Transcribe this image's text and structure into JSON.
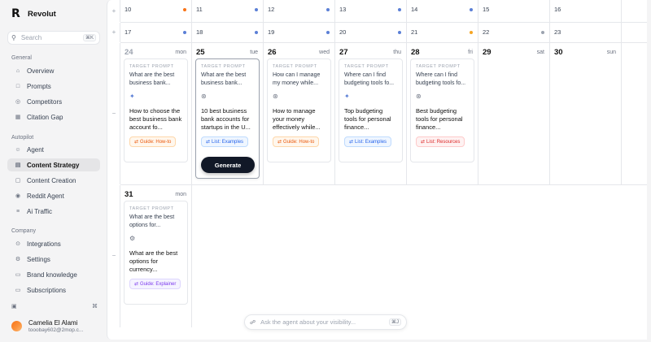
{
  "brand": {
    "logo": "R",
    "name": "Revolut"
  },
  "search": {
    "placeholder": "Search",
    "shortcut": "⌘K"
  },
  "sidebar": {
    "general_label": "General",
    "general": [
      {
        "label": "Overview",
        "icon": "house-icon"
      },
      {
        "label": "Prompts",
        "icon": "chat-icon"
      },
      {
        "label": "Competitors",
        "icon": "target-icon"
      },
      {
        "label": "Citation Gap",
        "icon": "grid-icon"
      }
    ],
    "autopilot_label": "Autopilot",
    "autopilot": [
      {
        "label": "Agent",
        "icon": "bot-icon"
      },
      {
        "label": "Content Strategy",
        "icon": "calendar-icon",
        "active": true
      },
      {
        "label": "Content Creation",
        "icon": "doc-icon"
      },
      {
        "label": "Reddit Agent",
        "icon": "reddit-icon"
      },
      {
        "label": "Ai Traffic",
        "icon": "traffic-icon"
      }
    ],
    "company_label": "Company",
    "company": [
      {
        "label": "Integrations",
        "icon": "plug-icon"
      },
      {
        "label": "Settings",
        "icon": "gear-icon"
      },
      {
        "label": "Brand knowledge",
        "icon": "book-icon"
      },
      {
        "label": "Subscriptions",
        "icon": "card-icon"
      }
    ],
    "footer_shortcut": "⌘",
    "user": {
      "name": "Camelia El Alami",
      "email": "tooobay602@2mop.c..."
    }
  },
  "calendar": {
    "week1": [
      {
        "day": "10",
        "dot": "#f97316"
      },
      {
        "day": "11",
        "dot": "#5b7fd6"
      },
      {
        "day": "12",
        "dot": "#5b7fd6"
      },
      {
        "day": "13",
        "dot": "#5b7fd6"
      },
      {
        "day": "14",
        "dot": "#5b7fd6"
      },
      {
        "day": "15",
        "dot": ""
      },
      {
        "day": "16",
        "dot": ""
      }
    ],
    "week2": [
      {
        "day": "17",
        "dot": "#5b7fd6"
      },
      {
        "day": "18",
        "dot": "#5b7fd6"
      },
      {
        "day": "19",
        "dot": "#5b7fd6"
      },
      {
        "day": "20",
        "dot": "#5b7fd6"
      },
      {
        "day": "21",
        "dot": "#f5a524"
      },
      {
        "day": "22",
        "dot": "#9ca3af"
      },
      {
        "day": "23",
        "dot": ""
      }
    ],
    "week3": [
      {
        "day": "24",
        "weekday": "mon",
        "muted": true,
        "card": {
          "label": "TARGET PROMPT",
          "prompt": "What are the best business bank...",
          "icon": "sparkle-icon",
          "title": "How to choose the best business bank account fo...",
          "tag": "Guide: How-to",
          "tag_type": "howto"
        }
      },
      {
        "day": "25",
        "weekday": "tue",
        "selected": true,
        "card": {
          "label": "TARGET PROMPT",
          "prompt": "What are the best business bank...",
          "icon": "openai-icon",
          "title": "10 best business bank accounts for startups in the U...",
          "tag": "List: Examples",
          "tag_type": "examples"
        },
        "button": "Generate"
      },
      {
        "day": "26",
        "weekday": "wed",
        "card": {
          "label": "TARGET PROMPT",
          "prompt": "How can I manage my money while...",
          "icon": "openai-icon",
          "title": "How to manage your money effectively while...",
          "tag": "Guide: How-to",
          "tag_type": "howto"
        }
      },
      {
        "day": "27",
        "weekday": "thu",
        "card": {
          "label": "TARGET PROMPT",
          "prompt": "Where can I find budgeting tools fo...",
          "icon": "sparkle-icon",
          "title": "Top budgeting tools for personal finance...",
          "tag": "List: Examples",
          "tag_type": "examples"
        }
      },
      {
        "day": "28",
        "weekday": "fri",
        "card": {
          "label": "TARGET PROMPT",
          "prompt": "Where can I find budgeting tools fo...",
          "icon": "openai-icon",
          "title": "Best budgeting tools for personal finance...",
          "tag": "List: Resources",
          "tag_type": "resources"
        }
      },
      {
        "day": "29",
        "weekday": "sat"
      },
      {
        "day": "30",
        "weekday": "sun"
      }
    ],
    "week4": [
      {
        "day": "31",
        "weekday": "mon",
        "card": {
          "label": "TARGET PROMPT",
          "prompt": "What are the best options for...",
          "icon": "gear-icon",
          "title": "What are the best options for currency...",
          "tag": "Guide: Explainer",
          "tag_type": "explainer"
        }
      }
    ]
  },
  "agent_input": {
    "placeholder": "Ask the agent about your visibility...",
    "shortcut": "⌘J"
  },
  "gutter": {
    "plus": "+",
    "minus": "−"
  }
}
